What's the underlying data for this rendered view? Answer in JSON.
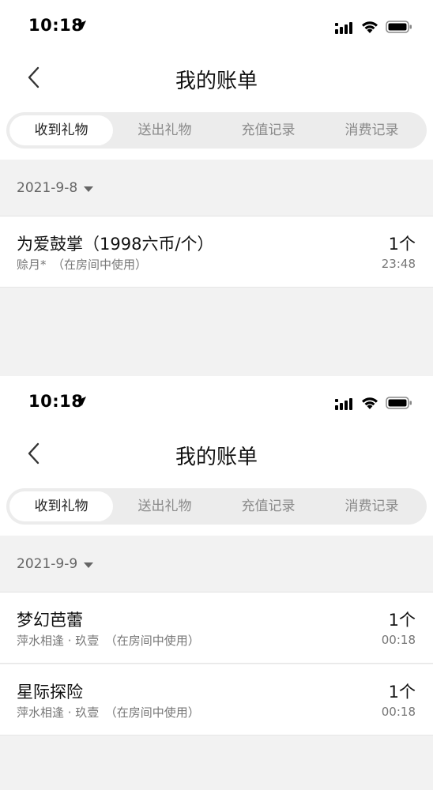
{
  "screens": [
    {
      "status_bar": {
        "time": "10:18"
      },
      "nav": {
        "title": "我的账单"
      },
      "tabs": [
        {
          "label": "收到礼物",
          "active": true
        },
        {
          "label": "送出礼物",
          "active": false
        },
        {
          "label": "充值记录",
          "active": false
        },
        {
          "label": "消费记录",
          "active": false
        }
      ],
      "date": "2021-9-8",
      "records": [
        {
          "title": "为爱鼓掌（1998六币/个）",
          "subtitle": "赊月*　（在房间中使用）",
          "count": "1个",
          "time": "23:48"
        }
      ]
    },
    {
      "status_bar": {
        "time": "10:18"
      },
      "nav": {
        "title": "我的账单"
      },
      "tabs": [
        {
          "label": "收到礼物",
          "active": true
        },
        {
          "label": "送出礼物",
          "active": false
        },
        {
          "label": "充值记录",
          "active": false
        },
        {
          "label": "消费记录",
          "active": false
        }
      ],
      "date": "2021-9-9",
      "records": [
        {
          "title": "梦幻芭蕾",
          "subtitle": "萍水相逢 · 玖壹　（在房间中使用）",
          "count": "1个",
          "time": "00:18"
        },
        {
          "title": "星际探险",
          "subtitle": "萍水相逢 · 玖壹　（在房间中使用）",
          "count": "1个",
          "time": "00:18"
        }
      ]
    }
  ],
  "icons": {
    "location": "location-arrow-icon",
    "signal": "cellular-signal-icon",
    "wifi": "wifi-icon",
    "battery": "battery-icon",
    "back": "chevron-left-icon",
    "caret": "caret-down-icon"
  },
  "colors": {
    "background": "#f2f2f2",
    "surface": "#ffffff",
    "tab_strip": "#ececec",
    "text_primary": "#111111",
    "text_secondary": "#777777",
    "tab_inactive": "#8a8a8a"
  }
}
